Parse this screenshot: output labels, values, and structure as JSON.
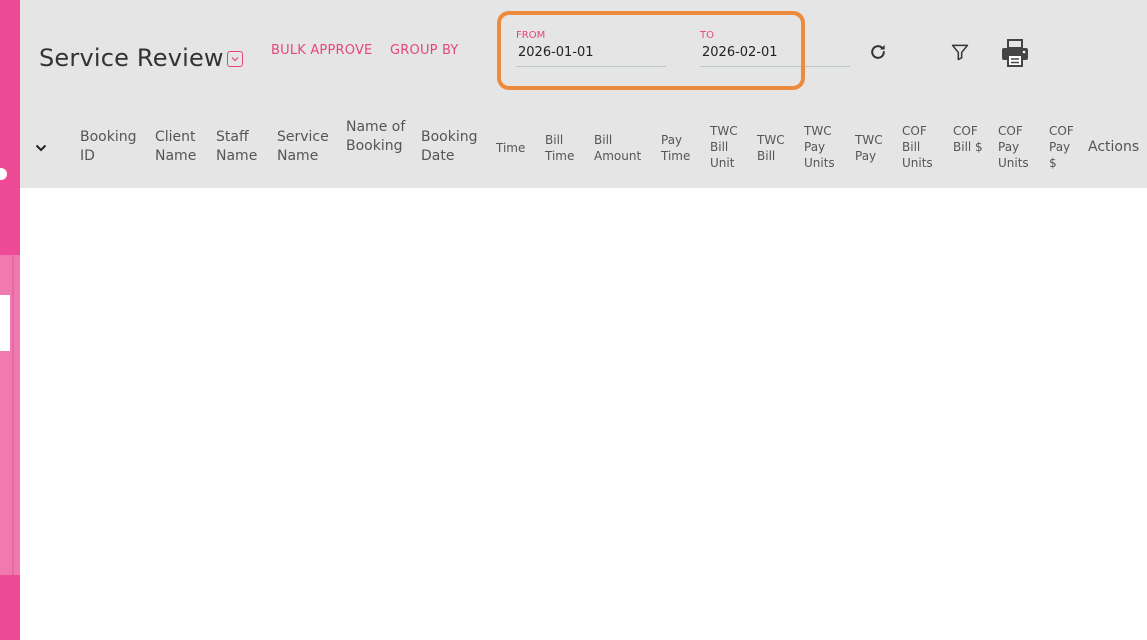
{
  "page": {
    "title": "Service Review"
  },
  "toolbar": {
    "bulk_approve_label": "BULK APPROVE",
    "group_by_label": "GROUP BY"
  },
  "date_range": {
    "from_label": "FROM",
    "from_value": "2026-01-01",
    "to_label": "TO",
    "to_value": "2026-02-01"
  },
  "icons": {
    "title_dropdown": "chevron-down-icon",
    "refresh": "refresh-icon",
    "filter": "filter-icon",
    "print": "printer-icon",
    "expand": "chevron-down-icon"
  },
  "colors": {
    "sidebar": "#ee4a95",
    "accent": "#e5467f",
    "highlight": "#ee8a3c",
    "header_bg": "#e5e5e5"
  },
  "table": {
    "columns": [
      {
        "label": "Booking ID"
      },
      {
        "label": "Client Name"
      },
      {
        "label": "Staff Name"
      },
      {
        "label": "Service Name"
      },
      {
        "label": "Name of Booking"
      },
      {
        "label": "Booking Date"
      },
      {
        "label": "Time"
      },
      {
        "label": "Bill Time"
      },
      {
        "label": "Bill Amount"
      },
      {
        "label": "Pay Time"
      },
      {
        "label": "TWC Bill Unit"
      },
      {
        "label": "TWC Bill"
      },
      {
        "label": "TWC Pay Units"
      },
      {
        "label": "TWC Pay"
      },
      {
        "label": "COF Bill Units"
      },
      {
        "label": "COF Bill $"
      },
      {
        "label": "COF Pay Units"
      },
      {
        "label": "COF Pay $"
      },
      {
        "label": "Actions"
      }
    ],
    "rows": []
  }
}
